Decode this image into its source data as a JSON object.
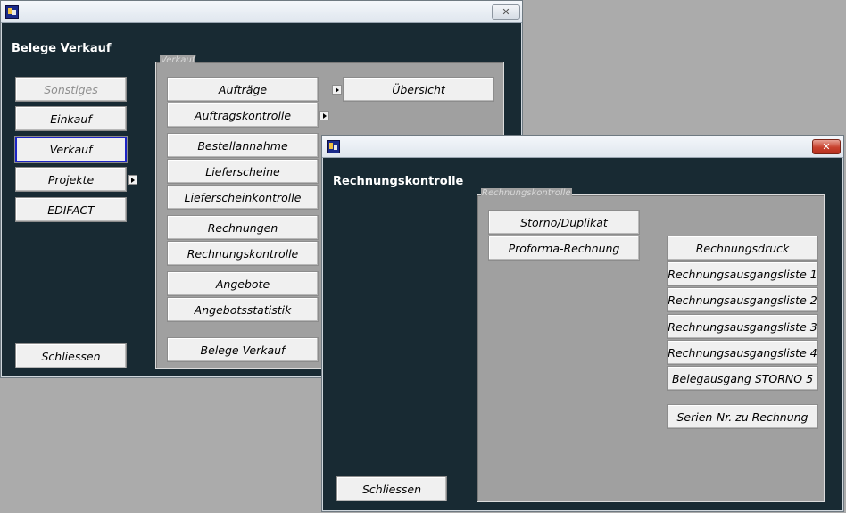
{
  "window1": {
    "title": "Belege Verkauf",
    "buttons": {
      "sonstiges": "Sonstiges",
      "einkauf": "Einkauf",
      "verkauf": "Verkauf",
      "projekte": "Projekte",
      "edifact": "EDIFACT",
      "schliessen": "Schliessen"
    },
    "group": {
      "legend": "Verkauf",
      "auftraege": "Aufträge",
      "uebersicht": "Übersicht",
      "auftragskontrolle": "Auftragskontrolle",
      "bestellannahme": "Bestellannahme",
      "lieferscheine": "Lieferscheine",
      "lieferscheinkontrolle": "Lieferscheinkontrolle",
      "rechnungen": "Rechnungen",
      "rechnungskontrolle": "Rechnungskontrolle",
      "angebote": "Angebote",
      "angebotsstatistik": "Angebotsstatistik",
      "belege_verkauf": "Belege Verkauf"
    }
  },
  "window2": {
    "title": "Rechnungskontrolle",
    "buttons": {
      "schliessen": "Schliessen"
    },
    "group": {
      "legend": "Rechnungskontrolle",
      "storno_duplikat": "Storno/Duplikat",
      "proforma": "Proforma-Rechnung",
      "rechnungsdruck": "Rechnungsdruck",
      "ausgangsliste_1": "Rechnungsausgangsliste 1",
      "ausgangsliste_2": "Rechnungsausgangsliste 2",
      "ausgangsliste_3": "Rechnungsausgangsliste 3",
      "ausgangsliste_4": "Rechnungsausgangsliste 4",
      "belegausgang_storno": "Belegausgang STORNO 5",
      "serien_nr": "Serien-Nr. zu Rechnung"
    }
  },
  "icons": {
    "app": "app-icon",
    "close": "close-icon",
    "submenu_arrow": "submenu-arrow-icon"
  }
}
